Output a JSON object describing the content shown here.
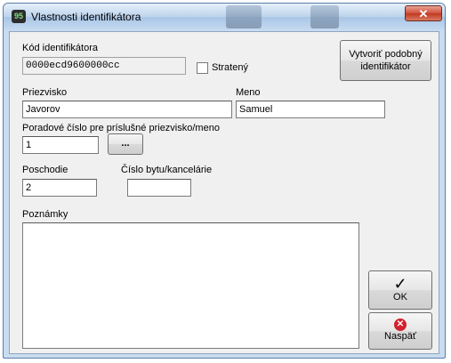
{
  "window": {
    "title": "Vlastnosti identifikátora",
    "icon": "app-logo-icon",
    "icon_glyph": "95",
    "close_glyph": "✕"
  },
  "form": {
    "code_label": "Kód identifikátora",
    "code_value": "0000ecd9600000cc",
    "lost_label": "Stratený",
    "lost_checked": false,
    "create_similar_label": "Vytvoriť podobný identifikátor",
    "surname_label": "Priezvisko",
    "surname_value": "Javorov",
    "name_label": "Meno",
    "name_value": "Samuel",
    "order_label": "Poradové číslo pre príslušné priezvisko/meno",
    "order_value": "1",
    "order_button_label": "...",
    "floor_label": "Poschodie",
    "floor_value": "2",
    "flat_label": "Číslo bytu/kancelárie",
    "flat_value": "",
    "notes_label": "Poznámky",
    "notes_value": ""
  },
  "buttons": {
    "ok_label": "OK",
    "ok_icon": "checkmark-icon",
    "ok_glyph": "✓",
    "back_label": "Naspäť",
    "back_icon": "red-x-circle-icon",
    "back_glyph": "✕"
  },
  "colors": {
    "titlebar": "#bcd3ec",
    "close_button": "#c8452c",
    "dialog_background": "#f0f0f0"
  }
}
